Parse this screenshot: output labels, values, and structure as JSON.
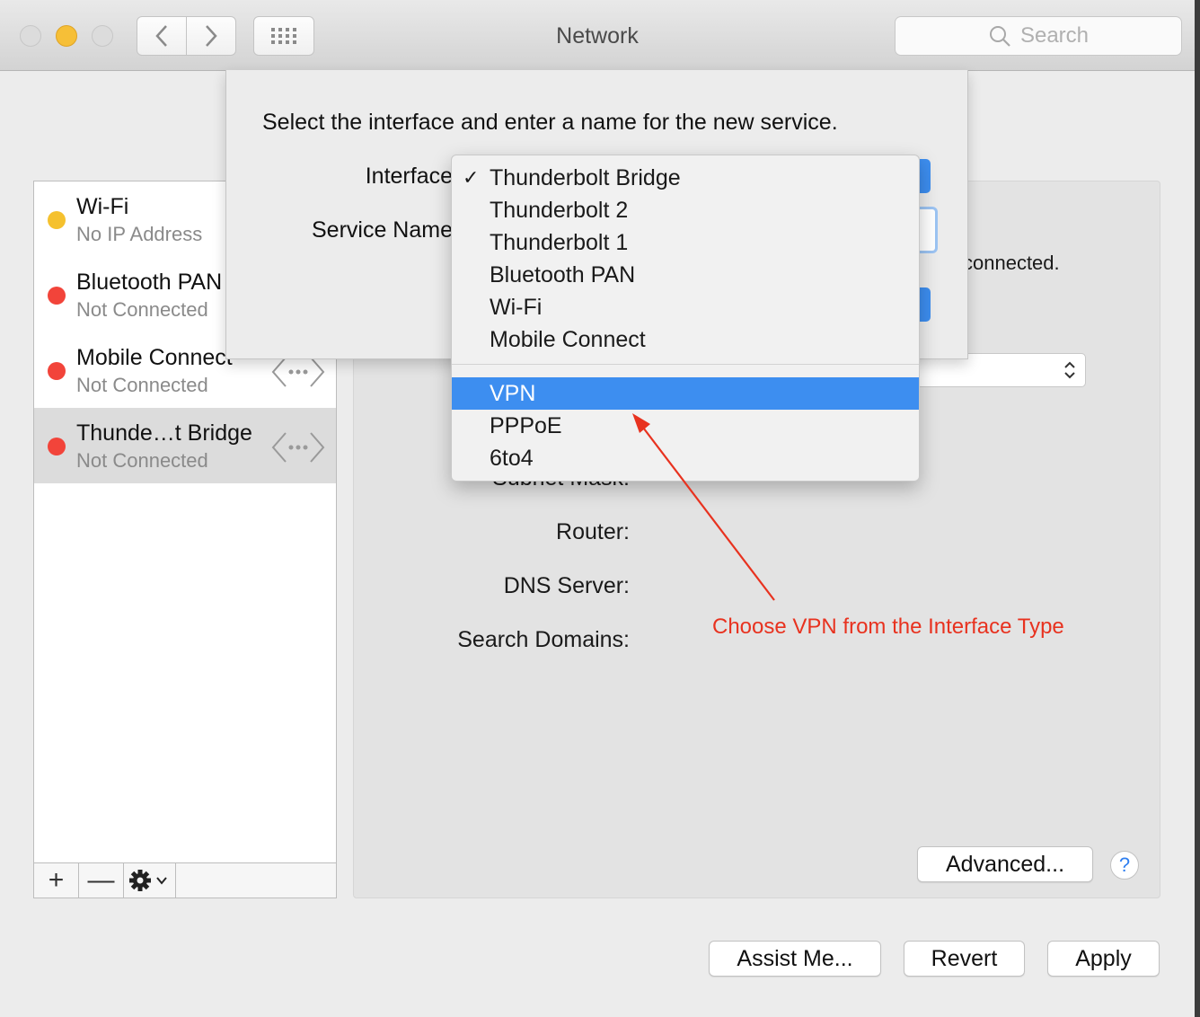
{
  "window": {
    "title": "Network"
  },
  "toolbar": {
    "search_placeholder": "Search"
  },
  "colors": {
    "accent": "#3d8ef0",
    "status_red": "#f2443a",
    "status_yellow": "#f5c12e",
    "annotation": "#e8321f"
  },
  "services": [
    {
      "name": "Wi-Fi",
      "status": "No IP Address",
      "color": "yellow"
    },
    {
      "name": "Bluetooth PAN",
      "status": "Not Connected",
      "color": "red"
    },
    {
      "name": "Mobile Connect",
      "status": "Not Connected",
      "color": "red"
    },
    {
      "name": "Thunde…t Bridge",
      "status": "Not Connected",
      "color": "red",
      "selected": true
    }
  ],
  "list_toolbar": {
    "add": "+",
    "remove": "—"
  },
  "detail": {
    "status_text": "connected.",
    "labels": {
      "subnet_mask": "Subnet Mask:",
      "router": "Router:",
      "dns_server": "DNS Server:",
      "search_domains": "Search Domains:"
    },
    "advanced_label": "Advanced...",
    "help_label": "?"
  },
  "footer": {
    "assist_label": "Assist Me...",
    "revert_label": "Revert",
    "apply_label": "Apply"
  },
  "sheet": {
    "prompt": "Select the interface and enter a name for the new service.",
    "interface_label": "Interface",
    "service_name_label": "Service Name"
  },
  "interface_menu": {
    "checked": "Thunderbolt Bridge",
    "group1": [
      "Thunderbolt Bridge",
      "Thunderbolt 2",
      "Thunderbolt 1",
      "Bluetooth PAN",
      "Wi-Fi",
      "Mobile Connect"
    ],
    "group2": [
      "VPN",
      "PPPoE",
      "6to4"
    ],
    "highlighted": "VPN"
  },
  "annotation": {
    "text": "Choose VPN from the Interface Type"
  }
}
